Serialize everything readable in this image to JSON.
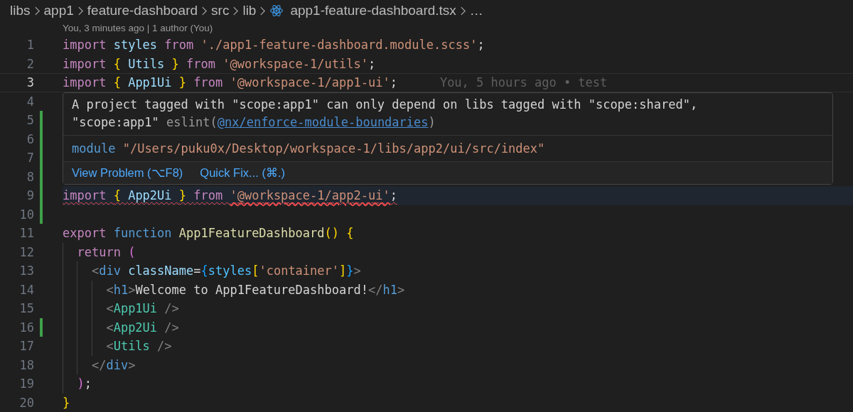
{
  "breadcrumb": {
    "segments": [
      {
        "label": "libs",
        "kind": "folder"
      },
      {
        "label": "app1",
        "kind": "folder"
      },
      {
        "label": "feature-dashboard",
        "kind": "folder"
      },
      {
        "label": "src",
        "kind": "folder"
      },
      {
        "label": "lib",
        "kind": "folder"
      },
      {
        "label": "app1-feature-dashboard.tsx",
        "kind": "react-file"
      },
      {
        "label": "…",
        "kind": "more"
      }
    ]
  },
  "codelens": "You, 3 minutes ago | 1 author (You)",
  "lines": [
    {
      "number": "1",
      "modified": false,
      "current": false,
      "error": false,
      "tokens": [
        {
          "text": "import ",
          "kind": "keyword"
        },
        {
          "text": "styles ",
          "kind": "variable"
        },
        {
          "text": "from ",
          "kind": "keyword"
        },
        {
          "text": "'./app1-feature-dashboard.module.scss'",
          "kind": "string"
        },
        {
          "text": ";",
          "kind": "plain"
        }
      ]
    },
    {
      "number": "2",
      "modified": false,
      "current": false,
      "error": false,
      "tokens": [
        {
          "text": "import ",
          "kind": "keyword"
        },
        {
          "text": "{ ",
          "kind": "bracket1"
        },
        {
          "text": "Utils ",
          "kind": "variable"
        },
        {
          "text": "} ",
          "kind": "bracket1"
        },
        {
          "text": "from ",
          "kind": "keyword"
        },
        {
          "text": "'@workspace-1/utils'",
          "kind": "string"
        },
        {
          "text": ";",
          "kind": "plain"
        }
      ]
    },
    {
      "number": "3",
      "modified": false,
      "current": true,
      "error": false,
      "blame": "You, 5 hours ago • test",
      "tokens": [
        {
          "text": "import ",
          "kind": "keyword"
        },
        {
          "text": "{ ",
          "kind": "bracket1"
        },
        {
          "text": "App1Ui ",
          "kind": "variable"
        },
        {
          "text": "} ",
          "kind": "bracket1"
        },
        {
          "text": "from ",
          "kind": "keyword"
        },
        {
          "text": "'@workspace-1/app1-ui'",
          "kind": "string"
        },
        {
          "text": ";",
          "kind": "plain"
        }
      ]
    },
    {
      "number": "4",
      "modified": false,
      "current": false,
      "error": false
    },
    {
      "number": "5",
      "modified": true,
      "current": false,
      "error": false
    },
    {
      "number": "6",
      "modified": true,
      "current": false,
      "error": false
    },
    {
      "number": "7",
      "modified": true,
      "current": false,
      "error": false
    },
    {
      "number": "8",
      "modified": true,
      "current": false,
      "error": false
    },
    {
      "number": "9",
      "modified": true,
      "current": false,
      "error": true,
      "tokens": [
        {
          "text": "import ",
          "kind": "keyword"
        },
        {
          "text": "{ ",
          "kind": "bracket1"
        },
        {
          "text": "App2Ui ",
          "kind": "variable"
        },
        {
          "text": "} ",
          "kind": "bracket1"
        },
        {
          "text": "from ",
          "kind": "keyword"
        },
        {
          "text": "'@workspace-1/app2-ui'",
          "kind": "link-string"
        },
        {
          "text": ";",
          "kind": "plain"
        }
      ]
    },
    {
      "number": "10",
      "modified": true,
      "current": false,
      "error": false
    },
    {
      "number": "11",
      "modified": false,
      "current": false,
      "error": false,
      "tokens": [
        {
          "text": "export ",
          "kind": "keyword"
        },
        {
          "text": "function ",
          "kind": "storage"
        },
        {
          "text": "App1FeatureDashboard",
          "kind": "function"
        },
        {
          "text": "() {",
          "kind": "bracket1"
        }
      ]
    },
    {
      "number": "12",
      "modified": false,
      "current": false,
      "error": false,
      "tokens": [
        {
          "text": "  return ",
          "kind": "keyword"
        },
        {
          "text": "(",
          "kind": "bracket2"
        }
      ]
    },
    {
      "number": "13",
      "modified": false,
      "current": false,
      "error": false,
      "tokens": [
        {
          "text": "    <",
          "kind": "punct"
        },
        {
          "text": "div ",
          "kind": "tag"
        },
        {
          "text": "className",
          "kind": "variable"
        },
        {
          "text": "=",
          "kind": "plain"
        },
        {
          "text": "{",
          "kind": "bracket3"
        },
        {
          "text": "styles",
          "kind": "constant"
        },
        {
          "text": "[",
          "kind": "bracket1"
        },
        {
          "text": "'container'",
          "kind": "string"
        },
        {
          "text": "]",
          "kind": "bracket1"
        },
        {
          "text": "}",
          "kind": "bracket3"
        },
        {
          "text": ">",
          "kind": "punct"
        }
      ]
    },
    {
      "number": "14",
      "modified": false,
      "current": false,
      "error": false,
      "tokens": [
        {
          "text": "      <",
          "kind": "punct"
        },
        {
          "text": "h1",
          "kind": "tag"
        },
        {
          "text": ">",
          "kind": "punct"
        },
        {
          "text": "Welcome to App1FeatureDashboard!",
          "kind": "plain"
        },
        {
          "text": "</",
          "kind": "punct"
        },
        {
          "text": "h1",
          "kind": "tag"
        },
        {
          "text": ">",
          "kind": "punct"
        }
      ]
    },
    {
      "number": "15",
      "modified": false,
      "current": false,
      "error": false,
      "tokens": [
        {
          "text": "      <",
          "kind": "punct"
        },
        {
          "text": "App1Ui ",
          "kind": "component"
        },
        {
          "text": "/>",
          "kind": "punct"
        }
      ]
    },
    {
      "number": "16",
      "modified": true,
      "current": false,
      "error": false,
      "tokens": [
        {
          "text": "      <",
          "kind": "punct"
        },
        {
          "text": "App2Ui ",
          "kind": "component"
        },
        {
          "text": "/>",
          "kind": "punct"
        }
      ]
    },
    {
      "number": "17",
      "modified": false,
      "current": false,
      "error": false,
      "tokens": [
        {
          "text": "      <",
          "kind": "punct"
        },
        {
          "text": "Utils ",
          "kind": "component"
        },
        {
          "text": "/>",
          "kind": "punct"
        }
      ]
    },
    {
      "number": "18",
      "modified": false,
      "current": false,
      "error": false,
      "tokens": [
        {
          "text": "    </",
          "kind": "punct"
        },
        {
          "text": "div",
          "kind": "tag"
        },
        {
          "text": ">",
          "kind": "punct"
        }
      ]
    },
    {
      "number": "19",
      "modified": false,
      "current": false,
      "error": false,
      "tokens": [
        {
          "text": "  )",
          "kind": "bracket2"
        },
        {
          "text": ";",
          "kind": "plain"
        }
      ]
    },
    {
      "number": "20",
      "modified": false,
      "current": false,
      "error": false,
      "tokens": [
        {
          "text": "}",
          "kind": "bracket1"
        }
      ]
    }
  ],
  "hover": {
    "message": "A project tagged with \"scope:app1\" can only depend on libs tagged with \"scope:shared\", \"scope:app1\"",
    "source": "eslint(",
    "rule_link": "@nx/enforce-module-boundaries",
    "source_end": ")",
    "module_keyword": "module",
    "module_path": "\"/Users/puku0x/Desktop/workspace-1/libs/app2/ui/src/index\"",
    "actions": [
      {
        "label": "View Problem (⌥F8)"
      },
      {
        "label": "Quick Fix... (⌘.)"
      }
    ]
  }
}
